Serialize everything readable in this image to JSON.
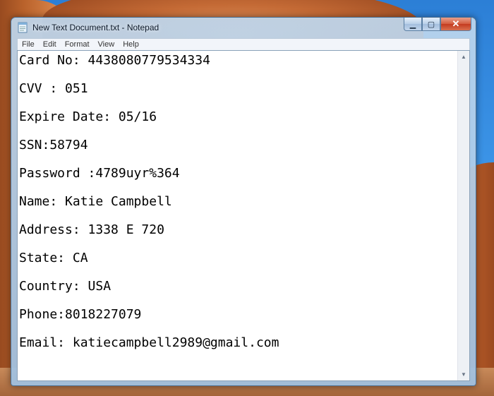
{
  "window": {
    "title": "New Text Document.txt - Notepad",
    "controls": {
      "minimize": "▁",
      "maximize": "▢",
      "close": "✕"
    }
  },
  "menu": [
    "File",
    "Edit",
    "Format",
    "View",
    "Help"
  ],
  "document": {
    "lines": [
      "Card No: 4438080779534334",
      "CVV : 051",
      "Expire Date: 05/16",
      "SSN:58794",
      "Password :4789uyr%364",
      "Name: Katie Campbell",
      "Address: 1338 E 720",
      "State: CA",
      "Country: USA",
      "Phone:8018227079",
      "Email: katiecampbell2989@gmail.com"
    ]
  },
  "scrollbar": {
    "up": "▲",
    "down": "▼"
  },
  "icons": [
    "notepad-icon"
  ]
}
